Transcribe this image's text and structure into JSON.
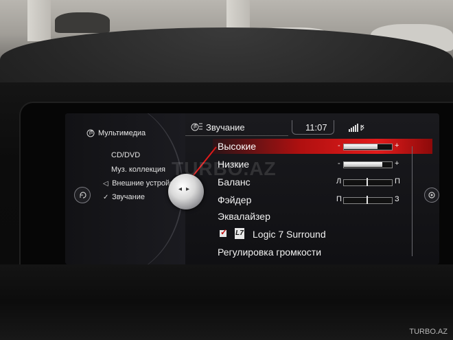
{
  "left_menu": {
    "title": "Мультимедиа",
    "items": [
      {
        "label": "CD/DVD",
        "mark": ""
      },
      {
        "label": "Муз. коллекция",
        "mark": ""
      },
      {
        "label": "Внешние устройст",
        "mark": "◁"
      },
      {
        "label": "Звучание",
        "mark": "✓"
      }
    ]
  },
  "header": {
    "title": "Звучание",
    "time": "11:07"
  },
  "rows": {
    "treble": {
      "label": "Высокие",
      "min": "-",
      "max": "+",
      "level": 0.72
    },
    "bass": {
      "label": "Низкие",
      "min": "-",
      "max": "+",
      "level": 0.82
    },
    "balance": {
      "label": "Баланс",
      "min": "Л",
      "max": "П",
      "position": 0.5
    },
    "fader": {
      "label": "Фэйдер",
      "min": "П",
      "max": "З",
      "position": 0.5
    },
    "equalizer": {
      "label": "Эквалайзер"
    },
    "logic7": {
      "label": "Logic 7 Surround",
      "checked": true,
      "logo": "L7"
    },
    "volume": {
      "label": "Регулировка громкости"
    }
  },
  "overlay": {
    "watermark": "TURBO.AZ",
    "site_label": "TURBO.AZ"
  },
  "colors": {
    "highlight": "#e21b1b",
    "screen_bg": "#121215",
    "text": "#f2f2f2"
  }
}
